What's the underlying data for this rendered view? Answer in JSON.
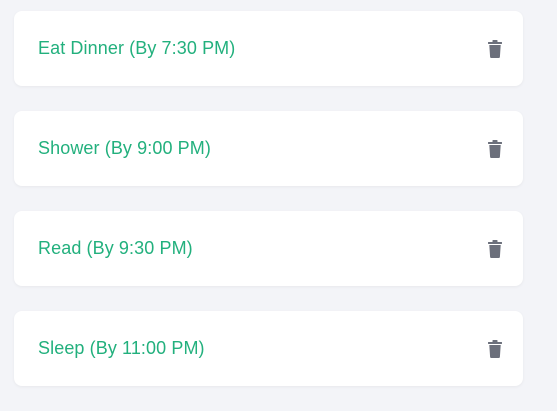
{
  "tasks": [
    {
      "label": "Eat Dinner (By 7:30 PM)",
      "action_icon": "trash-icon"
    },
    {
      "label": "Shower (By 9:00 PM)",
      "action_icon": "trash-icon"
    },
    {
      "label": "Read (By 9:30 PM)",
      "action_icon": "trash-icon"
    },
    {
      "label": "Sleep (By 11:00 PM)",
      "action_icon": "trash-icon"
    }
  ],
  "colors": {
    "background": "#f3f4f8",
    "card": "#ffffff",
    "task_text": "#22b07d",
    "icon": "#6b6f7b"
  }
}
